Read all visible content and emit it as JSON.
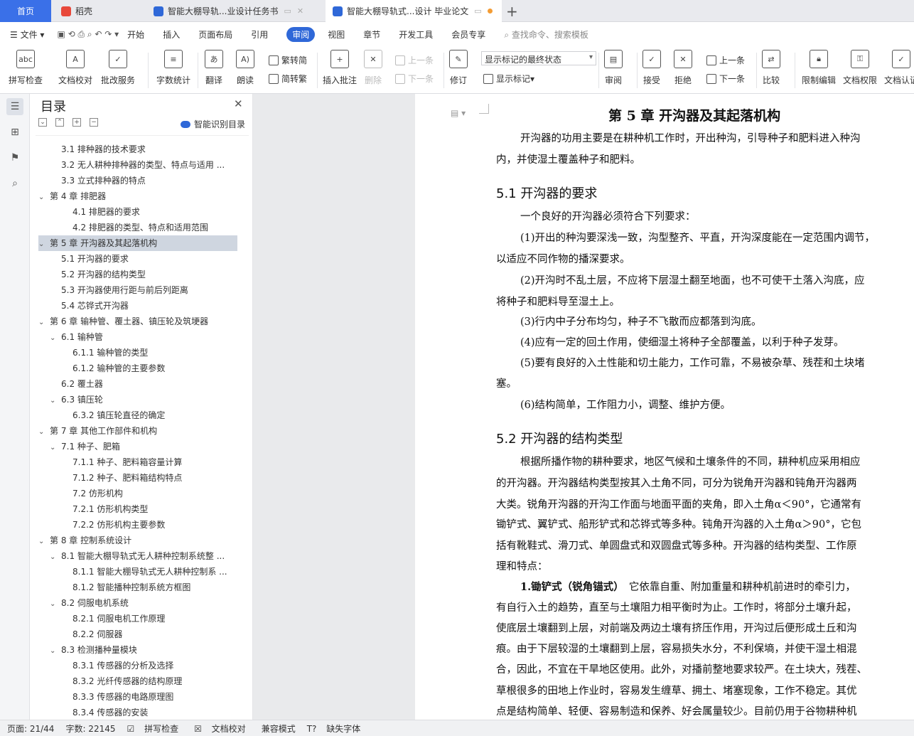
{
  "tabs": {
    "home": "首页",
    "t1": "稻壳",
    "t2": "智能大棚导轨...业设计任务书",
    "t3": "智能大棚导轨式...设计 毕业论文"
  },
  "menu": {
    "file": "文件",
    "items": [
      "开始",
      "插入",
      "页面布局",
      "引用",
      "审阅",
      "视图",
      "章节",
      "开发工具",
      "会员专享"
    ],
    "search": "查找命令、搜索模板"
  },
  "ribbon": {
    "spell": "拼写检查",
    "doccheck": "文档校对",
    "review_service": "批改服务",
    "wordcount": "字数统计",
    "translate": "翻译",
    "read": "朗读",
    "to_trad": "繁转简",
    "to_simp": "简转繁",
    "insert_comment": "插入批注",
    "delete": "删除",
    "prev": "上一条",
    "next": "下一条",
    "revise": "修订",
    "markup_state": "显示标记的最终状态",
    "show_markup": "显示标记",
    "review": "审阅",
    "accept": "接受",
    "reject": "拒绝",
    "prev2": "上一条",
    "next2": "下一条",
    "compare": "比较",
    "restrict": "限制编辑",
    "permission": "文档权限",
    "certify": "文档认证"
  },
  "toc": {
    "title": "目录",
    "smart": "智能识别目录",
    "items": [
      {
        "t": "3.1 排种器的技术要求",
        "l": 1
      },
      {
        "t": "3.2 无人耕种排种器的类型、特点与适用 ...",
        "l": 1
      },
      {
        "t": "3.3 立式排种器的特点",
        "l": 1
      },
      {
        "t": "第 4 章  排肥器",
        "l": 0,
        "c": true
      },
      {
        "t": "4.1 排肥器的要求",
        "l": 2
      },
      {
        "t": "4.2 排肥器的类型、特点和适用范围",
        "l": 2
      },
      {
        "t": "第 5 章  开沟器及其起落机构",
        "l": 0,
        "c": true,
        "s": true
      },
      {
        "t": "5.1 开沟器的要求",
        "l": 1
      },
      {
        "t": "5.2 开沟器的结构类型",
        "l": 1
      },
      {
        "t": "5.3 开沟器使用行距与前后列距离",
        "l": 1
      },
      {
        "t": "5.4 芯铧式开沟器",
        "l": 1
      },
      {
        "t": "第 6 章  输种管、覆土器、镇压轮及筑埂器",
        "l": 0,
        "c": true
      },
      {
        "t": "6.1 输种管",
        "l": 1,
        "c": true
      },
      {
        "t": "6.1.1 输种管的类型",
        "l": 2
      },
      {
        "t": "6.1.2 输种管的主要参数",
        "l": 2
      },
      {
        "t": "6.2 覆土器",
        "l": 1
      },
      {
        "t": "6.3 镇压轮",
        "l": 1,
        "c": true
      },
      {
        "t": "6.3.2 镇压轮直径的确定",
        "l": 2
      },
      {
        "t": "第 7 章  其他工作部件和机构",
        "l": 0,
        "c": true
      },
      {
        "t": "7.1 种子、肥箱",
        "l": 1,
        "c": true
      },
      {
        "t": "7.1.1 种子、肥料箱容量计算",
        "l": 2
      },
      {
        "t": "7.1.2 种子、肥料箱结构特点",
        "l": 2
      },
      {
        "t": "7.2 仿形机构",
        "l": 2
      },
      {
        "t": "7.2.1 仿形机构类型",
        "l": 2
      },
      {
        "t": "7.2.2 仿形机构主要参数",
        "l": 2
      },
      {
        "t": "第 8 章  控制系统设计",
        "l": 0,
        "c": true
      },
      {
        "t": "8.1 智能大棚导轨式无人耕种控制系统整 ...",
        "l": 1,
        "c": true
      },
      {
        "t": "8.1.1 智能大棚导轨式无人耕种控制系 ...",
        "l": 2
      },
      {
        "t": "8.1.2 智能播种控制系统方框图",
        "l": 2
      },
      {
        "t": "8.2 伺服电机系统",
        "l": 1,
        "c": true
      },
      {
        "t": "8.2.1 伺服电机工作原理",
        "l": 2
      },
      {
        "t": "8.2.2 伺服器",
        "l": 2
      },
      {
        "t": "8.3 检测播种量模块",
        "l": 1,
        "c": true
      },
      {
        "t": "8.3.1 传感器的分析及选择",
        "l": 2
      },
      {
        "t": "8.3.2 光纤传感器的结构原理",
        "l": 2
      },
      {
        "t": "8.3.3 传感器的电路原理图",
        "l": 2
      },
      {
        "t": "8.3.4 传感器的安装",
        "l": 2
      }
    ]
  },
  "doc": {
    "chapter": "第 5 章  开沟器及其起落机构",
    "h51": "5.1 开沟器的要求",
    "h52": "5.2 开沟器的结构类型",
    "lines": [
      "开沟器的功用主要是在耕种机工作时，开出种沟，引导种子和肥料进入种沟",
      "内，并使湿土覆盖种子和肥料。",
      "一个良好的开沟器必须符合下列要求：",
      "(1)开出的种沟要深浅一致，沟型整齐、平直，开沟深度能在一定范围内调节，",
      "以适应不同作物的播深要求。",
      "(2)开沟时不乱土层，不应将下层湿土翻至地面，也不可使干土落入沟底，应",
      "将种子和肥料导至湿土上。",
      "(3)行内中子分布均匀，种子不飞散而应都落到沟底。",
      "(4)应有一定的回土作用，使细湿土将种子全部覆盖，以利于种子发芽。",
      "(5)要有良好的入土性能和切土能力，工作可靠，不易被杂草、残茬和土块堵",
      "塞。",
      "(6)结构简单，工作阻力小，调整、维护方便。",
      "根据所播作物的耕种要求，地区气候和土壤条件的不同，耕种机应采用相应",
      "的开沟器。开沟器结构类型按其入土角不同，可分为锐角开沟器和钝角开沟器两",
      "大类。锐角开沟器的开沟工作面与地面平面的夹角，即入土角α＜90°，它通常有",
      "锄铲式、翼铲式、船形铲式和芯铧式等多种。钝角开沟器的入土角α＞90°，它包",
      "括有靴鞋式、滑刀式、单圆盘式和双圆盘式等多种。开沟器的结构类型、工作原",
      "理和特点：",
      "1.锄铲式（锐角锚式）　它依靠自重、附加重量和耕种机前进时的牵引力，",
      "有自行入土的趋势，直至与土壤阻力相平衡时为止。工作时，将部分土壤升起，",
      "使底层土壤翻到上层，对前端及两边土壤有挤压作用，开沟过后便形成土丘和沟",
      "痕。由于下层较湿的土壤翻到上层，容易损失水分，不利保墒，并使干湿土相混",
      "合，因此，不宜在干旱地区使用。此外，对播前整地要求较严。在土块大，残茬、",
      "草根很多的田地上作业时，容易发生缠草、拥土、堵塞现象，工作不稳定。其优",
      "点是结构简单、轻便、容易制造和保养、好会属量较少。目前仍用于谷物耕种机"
    ]
  },
  "status": {
    "page": "页面: 21/44",
    "words": "字数: 22145",
    "spell": "拼写检查",
    "doccheck": "文档校对",
    "compat": "兼容模式",
    "font": "缺失字体"
  }
}
